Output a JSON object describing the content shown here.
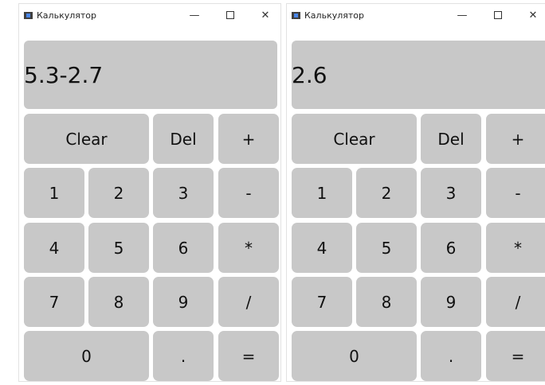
{
  "windows": [
    {
      "title": "Калькулятор",
      "display": "5.3-2.7",
      "controls": {
        "minimize": "—",
        "close": "✕"
      },
      "buttons": {
        "clear": "Clear",
        "del": "Del",
        "plus": "+",
        "one": "1",
        "two": "2",
        "three": "3",
        "minus": "-",
        "four": "4",
        "five": "5",
        "six": "6",
        "multiply": "*",
        "seven": "7",
        "eight": "8",
        "nine": "9",
        "divide": "/",
        "zero": "0",
        "dot": ".",
        "equals": "="
      }
    },
    {
      "title": "Калькулятор",
      "display": "2.6",
      "controls": {
        "minimize": "—",
        "close": "✕"
      },
      "buttons": {
        "clear": "Clear",
        "del": "Del",
        "plus": "+",
        "one": "1",
        "two": "2",
        "three": "3",
        "minus": "-",
        "four": "4",
        "five": "5",
        "six": "6",
        "multiply": "*",
        "seven": "7",
        "eight": "8",
        "nine": "9",
        "divide": "/",
        "zero": "0",
        "dot": ".",
        "equals": "="
      }
    }
  ]
}
